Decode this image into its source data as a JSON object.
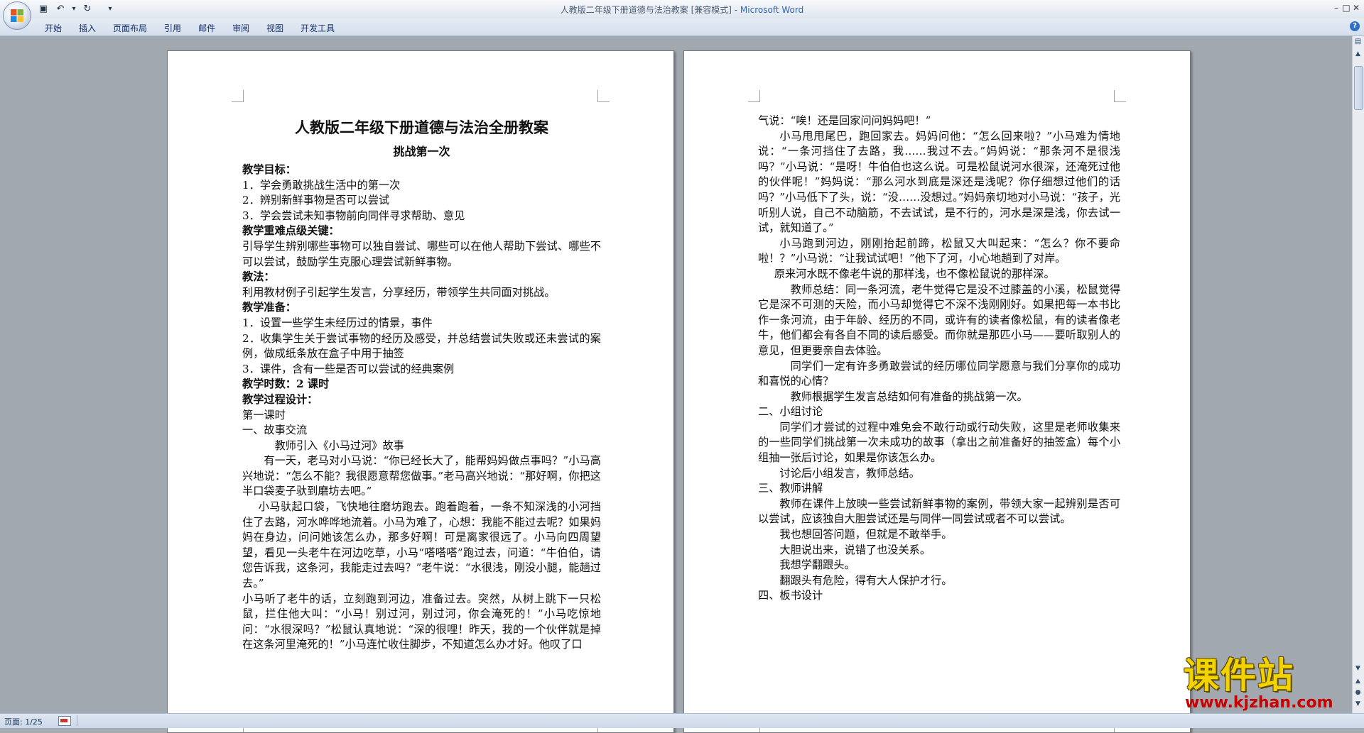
{
  "window": {
    "title": "人教版二年级下册道德与法治教案 [兼容模式] - ",
    "app_name": "Microsoft Word",
    "controls": [
      "–",
      "□",
      "✕"
    ]
  },
  "quick_access": {
    "save": "▣",
    "undo": "↶",
    "undo_dd": "▾",
    "redo": "↻",
    "customize": "▾"
  },
  "ribbon": {
    "tabs": [
      "开始",
      "插入",
      "页面布局",
      "引用",
      "邮件",
      "审阅",
      "视图",
      "开发工具"
    ],
    "help": "?"
  },
  "status": {
    "page": "页面: 1/25"
  },
  "page1": {
    "title": "人教版二年级下册道德与法治全册教案",
    "subtitle": "挑战第一次",
    "paragraphs": [
      {
        "t": "教学目标：",
        "bold": true
      },
      {
        "t": "1．学会勇敢挑战生活中的第一次"
      },
      {
        "t": "2．辨别新鲜事物是否可以尝试"
      },
      {
        "t": "3．学会尝试未知事物前向同伴寻求帮助、意见"
      },
      {
        "t": "教学重难点级关键：",
        "bold": true
      },
      {
        "t": "引导学生辨别哪些事物可以独自尝试、哪些可以在他人帮助下尝试、哪些不可以尝试，鼓励学生克服心理尝试新鲜事物。"
      },
      {
        "t": "教法：",
        "bold": true
      },
      {
        "t": "利用教材例子引起学生发言，分享经历，带领学生共同面对挑战。"
      },
      {
        "t": "教学准备：",
        "bold": true
      },
      {
        "t": "1．设置一些学生未经历过的情景，事件"
      },
      {
        "t": "2．收集学生关于尝试事物的经历及感受，并总结尝试失败或还未尝试的案例，做成纸条放在盒子中用于抽签"
      },
      {
        "t": "3．课件，含有一些是否可以尝试的经典案例"
      },
      {
        "t": "教学时数：2 课时",
        "bold": true
      },
      {
        "t": "教学过程设计：",
        "bold": true
      },
      {
        "t": "第一课时"
      },
      {
        "t": "一、故事交流"
      },
      {
        "t": "教师引入《小马过河》故事",
        "indent": "i3"
      },
      {
        "t": "有一天，老马对小马说：“你已经长大了，能帮妈妈做点事吗？”小马高兴地说：“怎么不能？我很愿意帮您做事。”老马高兴地说：“那好啊，你把这半口袋麦子驮到磨坊去吧。”",
        "indent": "i1"
      },
      {
        "t": "小马驮起口袋，飞快地往磨坊跑去。跑着跑着，一条不知深浅的小河挡住了去路，河水哗哗地流着。小马为难了，心想：我能不能过去呢？如果妈妈在身边，问问她该怎么办，那多好啊！可是离家很远了。小马向四周望望，看见一头老牛在河边吃草，小马“嗒嗒嗒”跑过去，问道：“牛伯伯，请您告诉我，这条河，我能走过去吗？”老牛说：“水很浅，刚没小腿，能趟过去。”",
        "indent": "i15"
      },
      {
        "t": "小马听了老牛的话，立刻跑到河边，准备过去。突然，从树上跳下一只松鼠，拦住他大叫：“小马！别过河，别过河，你会淹死的！”小马吃惊地问：“水很深吗？”松鼠认真地说：“深的很哩！昨天，我的一个伙伴就是掉在这条河里淹死的！”小马连忙收住脚步，不知道怎么办才好。他叹了口"
      }
    ]
  },
  "page2": {
    "paragraphs": [
      {
        "t": "气说：“唉！还是回家问问妈妈吧！”"
      },
      {
        "t": "小马甩甩尾巴，跑回家去。妈妈问他：“怎么回来啦？”小马难为情地说：“一条河挡住了去路，我……我过不去。”妈妈说：“那条河不是很浅吗？”小马说：“是呀！牛伯伯也这么说。可是松鼠说河水很深，还淹死过他的伙伴呢！”妈妈说：“那么河水到底是深还是浅呢？你仔细想过他们的话吗？”小马低下了头，说：“没……没想过。”妈妈亲切地对小马说：“孩子，光听别人说，自己不动脑筋，不去试试，是不行的，河水是深是浅，你去试一试，就知道了。”",
        "indent": "i1"
      },
      {
        "t": "小马跑到河边，刚刚抬起前蹄，松鼠又大叫起来：“怎么？你不要命啦！？”小马说：“让我试试吧！”他下了河，小心地趟到了对岸。",
        "indent": "i1"
      },
      {
        "t": "原来河水既不像老牛说的那样浅，也不像松鼠说的那样深。",
        "indent": "i15"
      },
      {
        "t": "教师总结：同一条河流，老牛觉得它是没不过膝盖的小溪，松鼠觉得它是深不可测的天险，而小马却觉得它不深不浅刚刚好。如果把每一本书比作一条河流，由于年龄、经历的不同，或许有的读者像松鼠，有的读者像老牛，他们都会有各自不同的读后感受。而你就是那匹小马——要听取别人的意见，但更要亲自去体验。",
        "indent": "i3"
      },
      {
        "t": "同学们一定有许多勇敢尝试的经历哪位同学愿意与我们分享你的成功和喜悦的心情？",
        "indent": "i3"
      },
      {
        "t": "教师根据学生发言总结如何有准备的挑战第一次。",
        "indent": "i3"
      },
      {
        "t": "二、小组讨论"
      },
      {
        "t": "同学们才尝试的过程中难免会不敢行动或行动失败，这里是老师收集来的一些同学们挑战第一次未成功的故事（拿出之前准备好的抽签盒）每个小组抽一张后讨论，如果是你该怎么办。",
        "indent": "i1"
      },
      {
        "t": "讨论后小组发言，教师总结。",
        "indent": "i1"
      },
      {
        "t": "三、教师讲解"
      },
      {
        "t": "教师在课件上放映一些尝试新鲜事物的案例，带领大家一起辨别是否可以尝试，应该独自大胆尝试还是与同伴一同尝试或者不可以尝试。",
        "indent": "i1"
      },
      {
        "t": "我也想回答问题，但就是不敢举手。",
        "indent": "i1"
      },
      {
        "t": "大胆说出来，说错了也没关系。",
        "indent": "i1"
      },
      {
        "t": "我想学翻跟头。",
        "indent": "i1"
      },
      {
        "t": "翻跟头有危险，得有大人保护才行。",
        "indent": "i1"
      },
      {
        "t": "四、板书设计"
      }
    ]
  },
  "watermark": {
    "text": "课件站",
    "url": "www.kjzhan.com"
  },
  "colors": {
    "workspace": "#a2a8b0",
    "ribbon": "#d4dfec",
    "accent": "#2e64b0",
    "watermark_yellow": "#f2d200",
    "watermark_red": "#c80000"
  }
}
